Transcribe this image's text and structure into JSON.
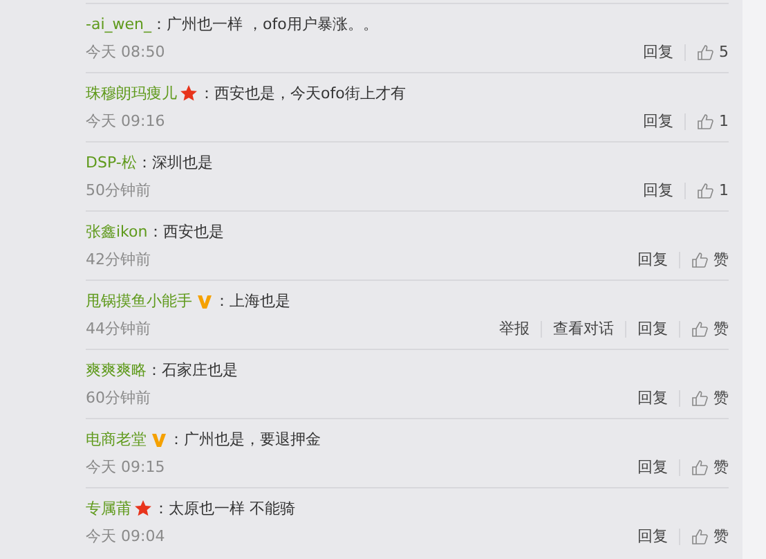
{
  "comments": [
    {
      "kind": "plain",
      "user": "-ai_wen_",
      "text": "：广州也一样 ，ofo用户暴涨。。",
      "time": "今天 08:50",
      "actions": [
        "回复"
      ],
      "likes": "5"
    },
    {
      "kind": "star",
      "user": "珠穆朗玛痩儿",
      "text": "：西安也是，今天ofo街上才有",
      "time": "今天 09:16",
      "actions": [
        "回复"
      ],
      "likes": "1"
    },
    {
      "kind": "plain",
      "user": "DSP-松",
      "text": "：深圳也是",
      "time": "50分钟前",
      "actions": [
        "回复"
      ],
      "likes": "1"
    },
    {
      "kind": "plain",
      "user": "张鑫ikon",
      "text": "：西安也是",
      "time": "42分钟前",
      "actions": [
        "回复"
      ],
      "likes": "赞"
    },
    {
      "kind": "vip",
      "user": "甩锅摸鱼小能手",
      "text": "：上海也是",
      "time": "44分钟前",
      "actions": [
        "举报",
        "查看对话",
        "回复"
      ],
      "likes": "赞"
    },
    {
      "kind": "plain",
      "user": "爽爽爽略",
      "text": "：石家庄也是",
      "time": "60分钟前",
      "actions": [
        "回复"
      ],
      "likes": "赞"
    },
    {
      "kind": "vip",
      "user": "电商老堂",
      "text": "：广州也是，要退押金",
      "time": "今天 09:15",
      "actions": [
        "回复"
      ],
      "likes": "赞"
    },
    {
      "kind": "star",
      "user": "专属莆",
      "text": "：太原也一样 不能骑",
      "time": "今天 09:04",
      "actions": [
        "回复"
      ],
      "likes": "赞"
    }
  ]
}
